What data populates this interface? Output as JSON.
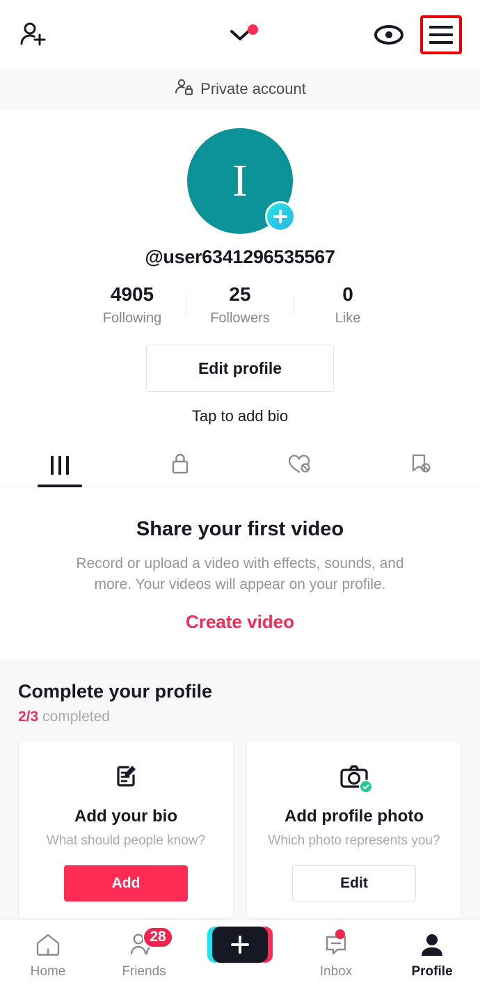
{
  "header": {
    "add_user_icon": "add-person-icon",
    "activity_icon": "chevron-down-icon",
    "activity_has_notification": true,
    "eye_icon": "eye-icon",
    "menu_icon": "hamburger-menu-icon",
    "menu_highlight_color": "#ee0000"
  },
  "private_banner": {
    "icon": "person-lock-icon",
    "label": "Private account"
  },
  "profile": {
    "avatar_letter": "I",
    "avatar_color": "#0c9299",
    "add_story_badge": "plus-icon",
    "handle": "@user6341296535567",
    "stats": [
      {
        "value": "4905",
        "label": "Following"
      },
      {
        "value": "25",
        "label": "Followers"
      },
      {
        "value": "0",
        "label": "Like"
      }
    ],
    "edit_profile_label": "Edit profile",
    "bio_placeholder": "Tap to add bio"
  },
  "tabs": [
    {
      "name": "videos",
      "icon": "grid-bars-icon",
      "active": true
    },
    {
      "name": "private",
      "icon": "lock-icon",
      "active": false
    },
    {
      "name": "liked",
      "icon": "heart-hidden-icon",
      "active": false
    },
    {
      "name": "favorites",
      "icon": "bookmark-hidden-icon",
      "active": false
    }
  ],
  "empty_state": {
    "title": "Share your first video",
    "description": "Record or upload a video with effects, sounds, and more. Your videos will appear on your profile.",
    "cta_label": "Create video",
    "cta_color": "#f02c56"
  },
  "complete_profile": {
    "title": "Complete your profile",
    "progress_count": "2/3",
    "progress_suffix": "completed",
    "progress_color": "#e8315c",
    "cards": [
      {
        "icon": "note-edit-icon",
        "title": "Add your bio",
        "description": "What should people know?",
        "button_label": "Add",
        "button_style": "primary",
        "completed": false
      },
      {
        "icon": "camera-icon",
        "title": "Add profile photo",
        "description": "Which photo represents you?",
        "button_label": "Edit",
        "button_style": "ghost",
        "completed": true
      }
    ]
  },
  "bottom_nav": [
    {
      "icon": "home-icon",
      "label": "Home",
      "active": false,
      "badge": null,
      "dot": false
    },
    {
      "icon": "friends-icon",
      "label": "Friends",
      "active": false,
      "badge": "28",
      "dot": false
    },
    {
      "icon": "create-plus-icon",
      "label": "",
      "active": false,
      "badge": null,
      "dot": false
    },
    {
      "icon": "inbox-icon",
      "label": "Inbox",
      "active": false,
      "badge": null,
      "dot": true
    },
    {
      "icon": "profile-person-icon",
      "label": "Profile",
      "active": true,
      "badge": null,
      "dot": false
    }
  ]
}
